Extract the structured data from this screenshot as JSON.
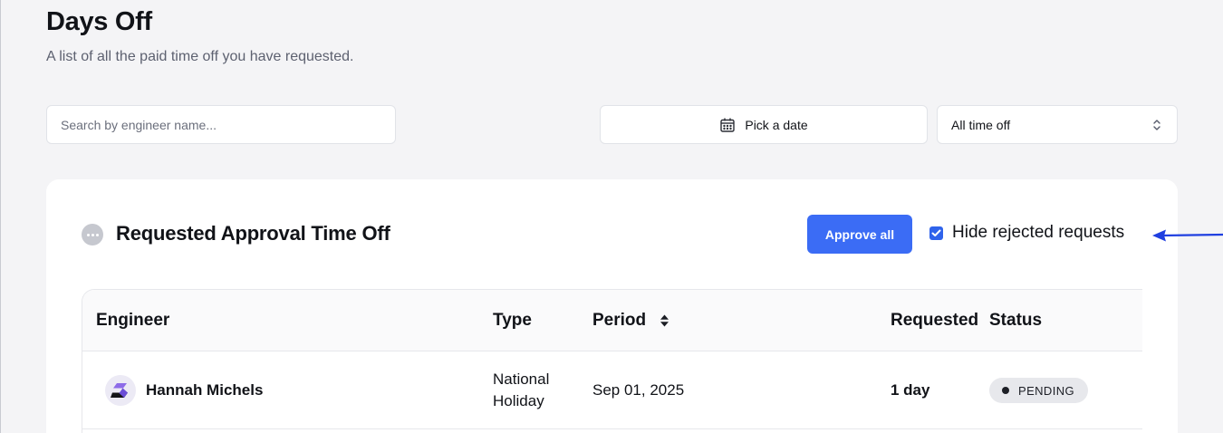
{
  "page": {
    "title": "Days Off",
    "subtitle": "A list of all the paid time off you have requested."
  },
  "filters": {
    "search_placeholder": "Search by engineer name...",
    "search_value": "",
    "date_picker_label": "Pick a date",
    "type_select_value": "All time off"
  },
  "requests_section": {
    "title": "Requested Approval Time Off",
    "approve_all_label": "Approve all",
    "hide_rejected_label": "Hide rejected requests",
    "hide_rejected_checked": true
  },
  "table": {
    "columns": [
      "Engineer",
      "Type",
      "Period",
      "Requested",
      "Status"
    ],
    "rows": [
      {
        "engineer": "Hannah Michels",
        "type_line1": "National",
        "type_line2": "Holiday",
        "period": "Sep 01, 2025",
        "requested": "1 day",
        "status": "PENDING"
      }
    ]
  },
  "colors": {
    "accent": "#3b6cf5",
    "annotation_arrow": "#1f3fe0",
    "page_background": "#f4f4f6",
    "status_badge": "#e7e8ec"
  },
  "icons": {
    "date_picker": "calendar-icon",
    "type_select": "chevron-up-down-icon",
    "section": "more-horizontal-icon",
    "sort": "sort-icon",
    "avatar": "company-logo-icon"
  }
}
